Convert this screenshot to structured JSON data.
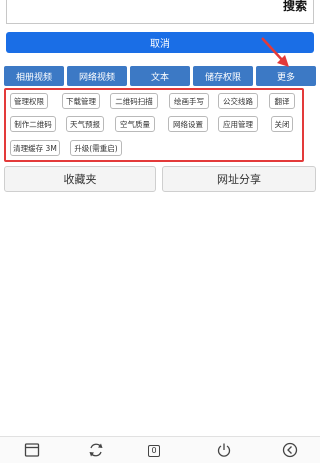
{
  "search": {
    "button_label": "搜索"
  },
  "cancel_label": "取消",
  "tabs": [
    "相册视频",
    "网络视频",
    "文本",
    "储存权限",
    "更多"
  ],
  "functions": [
    "管理权限",
    "下载管理",
    "二维码扫描",
    "绘画手写",
    "公交线路",
    "翻译",
    "制作二维码",
    "天气预报",
    "空气质量",
    "网络设置",
    "应用管理",
    "关闭",
    "清理缓存 3M",
    "升级(需重启)"
  ],
  "favorites_label": "收藏夹",
  "share_label": "网址分享",
  "bottom_bar": {
    "tab_count": "0"
  },
  "colors": {
    "accent": "#1a6ee6",
    "tab": "#3c79c5",
    "highlight": "#e33a3a"
  }
}
